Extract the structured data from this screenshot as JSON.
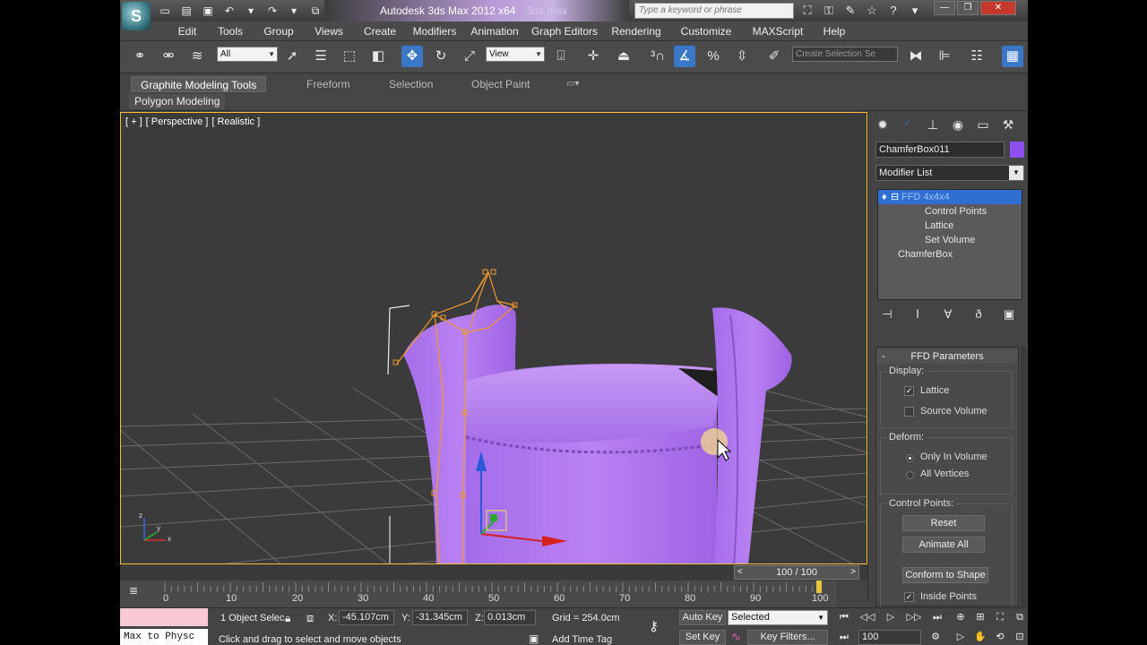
{
  "window": {
    "title": "Autodesk 3ds Max  2012 x64",
    "file": "3ds.max",
    "search_placeholder": "Type a keyword or phrase",
    "controls": [
      "—",
      "❐",
      "✕"
    ]
  },
  "quick_access": {
    "icons": [
      "new-icon",
      "open-icon",
      "save-icon",
      "undo-icon",
      "undo-dropdown-icon",
      "redo-icon",
      "redo-dropdown-icon",
      "project-icon",
      "customize-dropdown-icon"
    ],
    "glyphs": [
      "▭",
      "▤",
      "▣",
      "↶",
      "▾",
      "↷",
      "▾",
      "⧉",
      "▾"
    ]
  },
  "menu": {
    "items": [
      "Edit",
      "Tools",
      "Group",
      "Views",
      "Create",
      "Modifiers",
      "Animation",
      "Graph Editors",
      "Rendering",
      "Customize",
      "MAXScript",
      "Help"
    ]
  },
  "toolbar": {
    "selection_filter": "All",
    "ref_coord": "View",
    "named_selection_placeholder": "Create Selection Se"
  },
  "ribbon": {
    "tabs": [
      "Graphite Modeling Tools",
      "Freeform",
      "Selection",
      "Object Paint"
    ],
    "active_tab": "Graphite Modeling Tools",
    "sub_tab": "Polygon Modeling"
  },
  "viewport": {
    "label_plus": "[ + ]",
    "label_view": "[ Perspective ]",
    "label_shading": "[ Realistic ]",
    "object_color": "#b47cf0"
  },
  "timeline": {
    "frame_display": "100 / 100",
    "prev": "<",
    "next": ">",
    "ticks": [
      "0",
      "10",
      "20",
      "30",
      "40",
      "50",
      "60",
      "70",
      "80",
      "90",
      "100"
    ],
    "current_frame": 100,
    "total_frames": 100
  },
  "command_panel": {
    "tabs": [
      "create-icon",
      "modify-icon",
      "hierarchy-icon",
      "motion-icon",
      "display-icon",
      "utilities-icon"
    ],
    "object_name": "ChamferBox011",
    "object_color": "#8c4ff0",
    "modifier_list": "Modifier List",
    "stack": [
      {
        "label": "FFD 4x4x4",
        "selected": true
      },
      {
        "label": "Control Points",
        "selected": false
      },
      {
        "label": "Lattice",
        "selected": false
      },
      {
        "label": "Set Volume",
        "selected": false
      },
      {
        "label": "ChamferBox",
        "selected": false
      }
    ],
    "rollout_title": "FFD Parameters",
    "rollout_collapse": "-",
    "display_group": "Display:",
    "lattice": "Lattice",
    "source_volume": "Source Volume",
    "deform_group": "Deform:",
    "only_in_volume": "Only In Volume",
    "all_vertices": "All Vertices",
    "control_points_group": "Control Points:",
    "reset": "Reset",
    "animate_all": "Animate All",
    "conform": "Conform to Shape",
    "inside_points": "Inside Points"
  },
  "status": {
    "maxscript": "Max to Physc",
    "selected_count": "1 Object Selec",
    "x_label": "X:",
    "x": "-45.107cm",
    "y_label": "Y:",
    "y": "-31.345cm",
    "z_label": "Z:",
    "z": "0.013cm",
    "grid": "Grid = 254.0cm",
    "prompt": "Click and drag to select and move objects",
    "add_time_tag": "Add Time Tag",
    "auto_key": "Auto Key",
    "set_key": "Set Key",
    "selected_dd": "Selected",
    "key_filters": "Key Filters...",
    "frame": "100"
  }
}
